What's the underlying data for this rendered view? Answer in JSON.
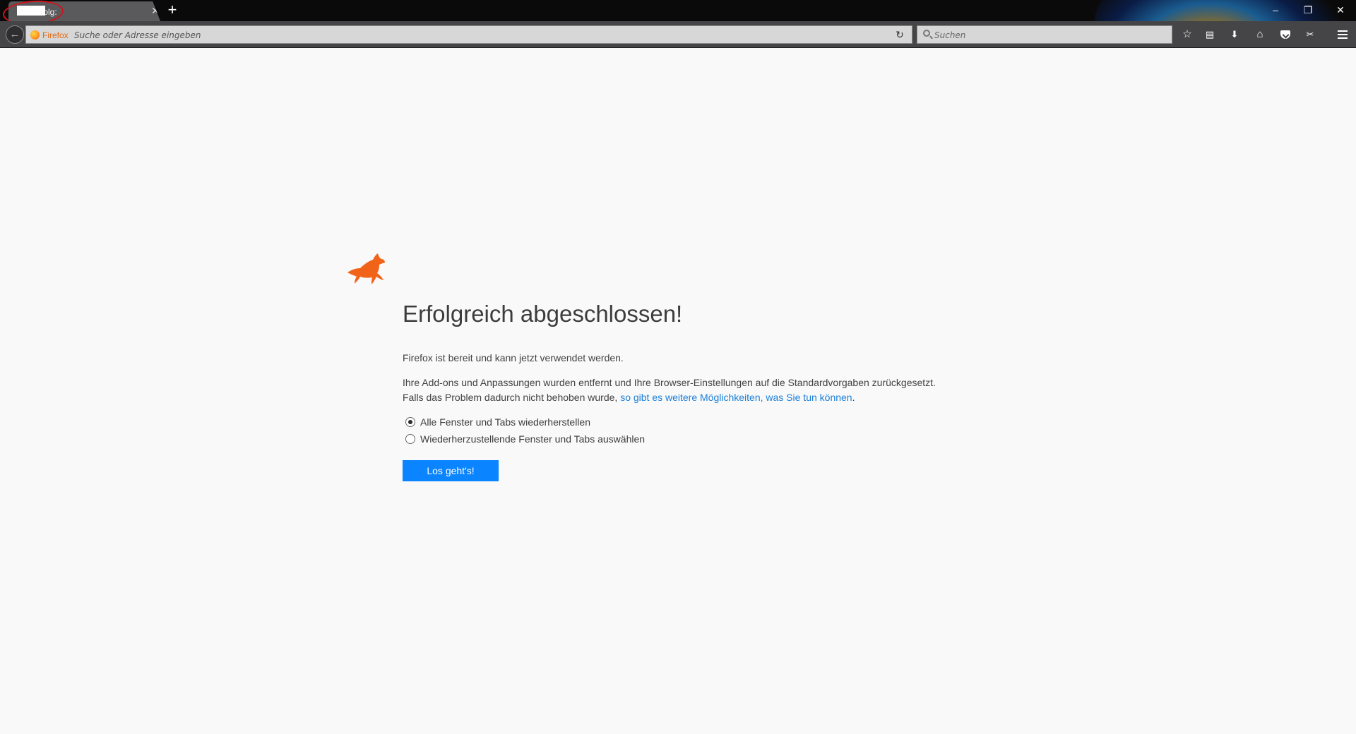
{
  "tab": {
    "title": "Erfolgreich abgeschlossen!",
    "visible_label": "folg:",
    "close_glyph": "✕",
    "new_tab_glyph": "+"
  },
  "window_controls": {
    "minimize": "–",
    "restore": "❐",
    "close": "✕"
  },
  "toolbar": {
    "back_glyph": "←",
    "identity_label": "Firefox",
    "url_placeholder": "Suche oder Adresse eingeben",
    "reload_glyph": "↻",
    "search_placeholder": "Suchen",
    "icons": [
      "star-bookmark-icon",
      "reading-list-icon",
      "download-icon",
      "home-icon",
      "pocket-icon",
      "tools-icon",
      "hamburger-menu-icon"
    ],
    "glyphs": {
      "bookmark": "☆",
      "reading_list": "▤",
      "download": "⬇",
      "home": "⌂",
      "tools": "✂"
    }
  },
  "page": {
    "heading": "Erfolgreich abgeschlossen!",
    "paragraph1": "Firefox ist bereit und kann jetzt verwendet werden.",
    "paragraph2_text": "Ihre Add-ons und Anpassungen wurden entfernt und Ihre Browser-Einstellungen auf die Standardvorgaben zurückgesetzt. Falls das Problem dadurch nicht behoben wurde, ",
    "paragraph2_link": "so gibt es weitere Möglichkeiten, was Sie tun können",
    "paragraph2_end": ".",
    "radio_options": [
      {
        "label": "Alle Fenster und Tabs wiederherstellen",
        "checked": true
      },
      {
        "label": "Wiederherzustellende Fenster und Tabs auswählen",
        "checked": false
      }
    ],
    "button_label": "Los geht's!"
  },
  "colors": {
    "accent_button": "#0a84ff",
    "link": "#1b7fd7",
    "fox": "#f2631a",
    "identity": "#e26a12"
  }
}
